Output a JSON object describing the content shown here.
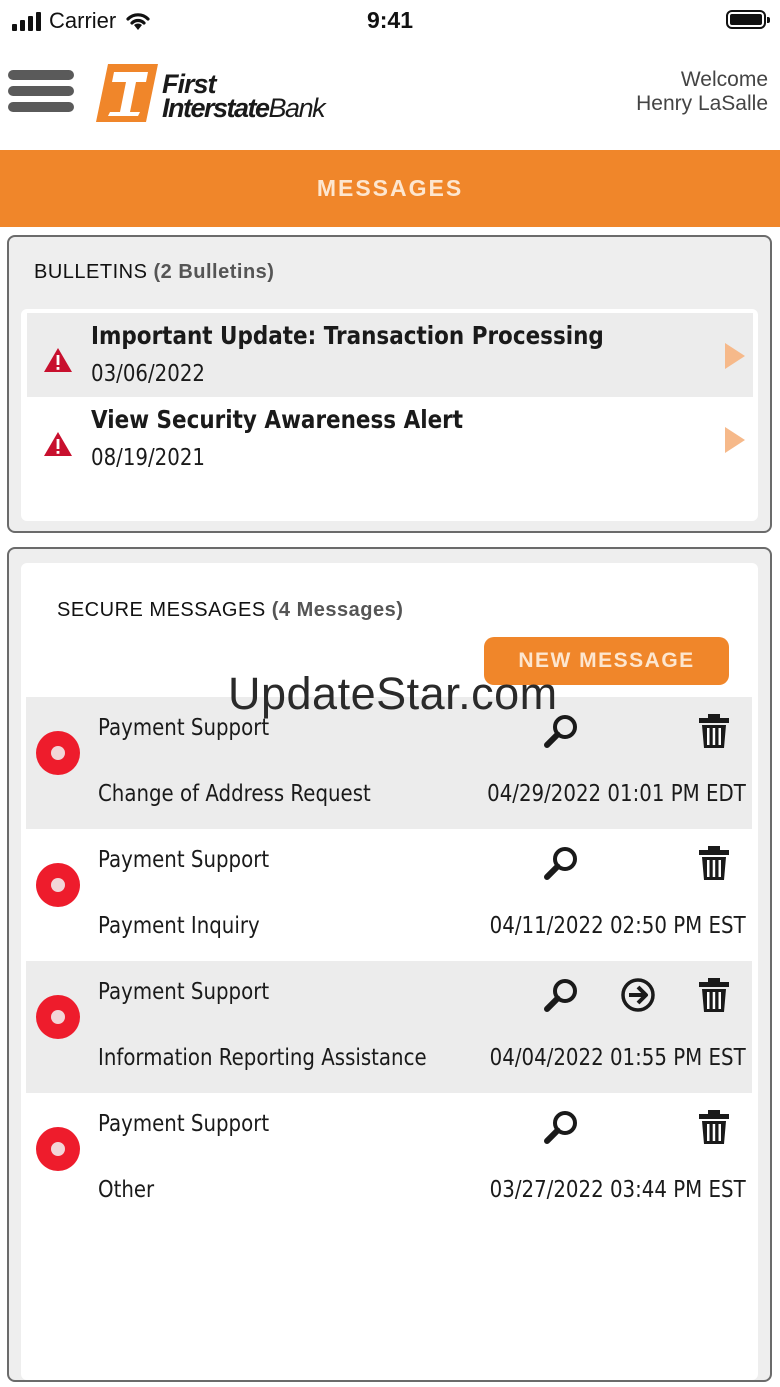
{
  "status_bar": {
    "carrier": "Carrier",
    "time": "9:41"
  },
  "header": {
    "logo_line1": "First",
    "logo_line2_bold": "Interstate",
    "logo_line2_thin": "Bank",
    "welcome_line1": "Welcome",
    "welcome_line2": "Henry LaSalle"
  },
  "page_title": "MESSAGES",
  "bulletins": {
    "heading": "BULLETINS",
    "count": "(2 Bulletins)",
    "items": [
      {
        "title": "Important Update: Transaction Processing",
        "date": "03/06/2022"
      },
      {
        "title": "View Security Awareness Alert",
        "date": "08/19/2021"
      }
    ]
  },
  "secure_messages": {
    "heading": "SECURE MESSAGES",
    "count": "(4 Messages)",
    "new_message_label": "NEW MESSAGE",
    "items": [
      {
        "from": "Payment Support",
        "subject": "Change of Address Request",
        "date": "04/29/2022 01:01 PM EDT",
        "has_forward": false
      },
      {
        "from": "Payment Support",
        "subject": "Payment Inquiry",
        "date": "04/11/2022 02:50 PM EST",
        "has_forward": false
      },
      {
        "from": "Payment Support",
        "subject": "Information Reporting Assistance",
        "date": "04/04/2022 01:55 PM EST",
        "has_forward": true
      },
      {
        "from": "Payment Support",
        "subject": "Other",
        "date": "03/27/2022 03:44 PM EST",
        "has_forward": false
      }
    ]
  },
  "watermark": "UpdateStar.com",
  "colors": {
    "brand_orange": "#f0862a",
    "unread_red": "#ee1c2c",
    "alert_red": "#c8102e"
  }
}
